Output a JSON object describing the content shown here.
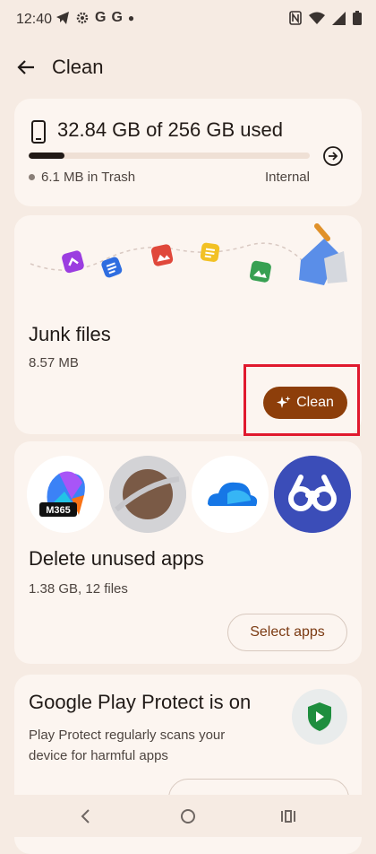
{
  "status_bar": {
    "time": "12:40",
    "left_icons": [
      "telegram-icon",
      "settings-icon",
      "google-icon",
      "google-icon",
      "dot-icon"
    ],
    "right_icons": [
      "nfc-icon",
      "wifi-icon",
      "signal-icon",
      "battery-icon"
    ]
  },
  "header": {
    "title": "Clean"
  },
  "storage": {
    "title": "32.84 GB of 256 GB used",
    "used_fraction": 0.128,
    "trash": "6.1 MB in Trash",
    "location": "Internal"
  },
  "junk": {
    "title": "Junk files",
    "size": "8.57 MB",
    "clean_label": "Clean"
  },
  "unused_apps": {
    "title": "Delete unused apps",
    "subtitle": "1.38 GB, 12 files",
    "select_label": "Select apps",
    "app_icons": [
      "M365"
    ]
  },
  "play_protect": {
    "title": "Google Play Protect is on",
    "description": "Play Protect regularly scans your device for harmful apps"
  },
  "colors": {
    "background": "#f6ebe3",
    "card": "#fcf5f0",
    "accent": "#8d3e0a",
    "highlight": "#e0192e"
  }
}
